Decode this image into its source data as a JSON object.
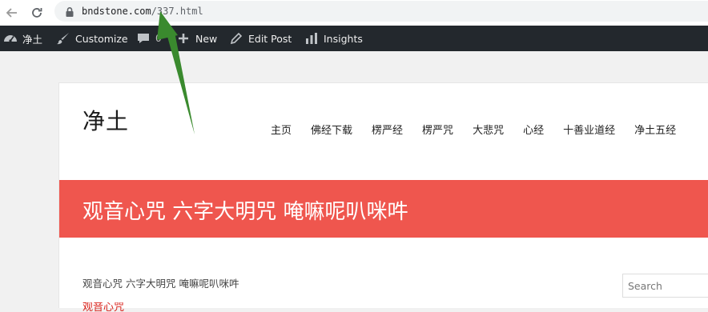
{
  "browser": {
    "url_domain": "bndstone.com",
    "url_path": "/337.html"
  },
  "admin_bar": {
    "site_name": "净土",
    "customize": "Customize",
    "comments_count": "0",
    "new": "New",
    "edit_post": "Edit Post",
    "insights": "Insights"
  },
  "site": {
    "title": "净土",
    "nav": [
      "主页",
      "佛经下载",
      "楞严经",
      "楞严咒",
      "大悲咒",
      "心经",
      "十善业道经",
      "净土五经"
    ]
  },
  "post": {
    "hero_title": "观音心咒 六字大明咒 唵嘛呢叭咪吽",
    "breadcrumb": "观音心咒 六字大明咒 唵嘛呢叭咪吽",
    "partial_link": "观音心咒"
  },
  "sidebar": {
    "search_placeholder": "Search"
  },
  "colors": {
    "admin_bar": "#23282d",
    "hero": "#ef564e",
    "annotation_arrow": "#3a8a2e"
  }
}
